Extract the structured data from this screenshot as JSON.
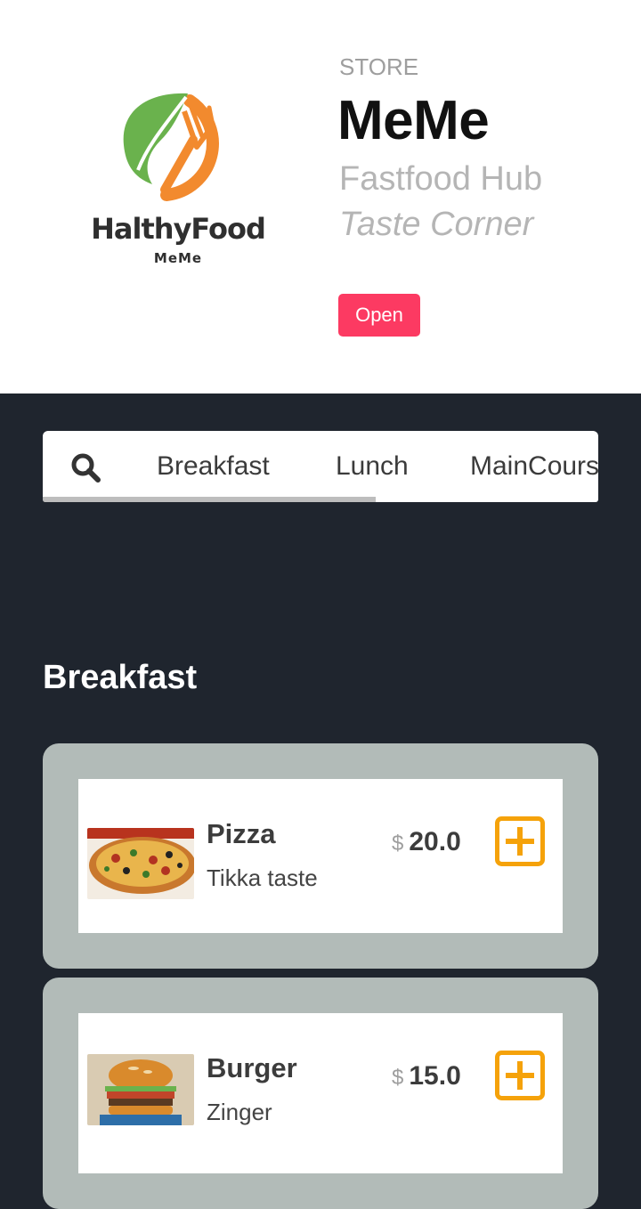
{
  "store": {
    "logo_name": "HalthyFood",
    "logo_sub": "MeMe",
    "label": "STORE",
    "name": "MeMe",
    "tagline": "Fastfood Hub",
    "tagline2": "Taste Corner",
    "status": "Open"
  },
  "tabs": [
    {
      "label": "Breakfast"
    },
    {
      "label": "Lunch"
    },
    {
      "label": "MainCourse"
    }
  ],
  "section": {
    "title": "Breakfast"
  },
  "items": [
    {
      "name": "Pizza",
      "description": "Tikka taste",
      "currency": "$",
      "price": "20.0",
      "image_icon": "pizza-photo"
    },
    {
      "name": "Burger",
      "description": "Zinger",
      "currency": "$",
      "price": "15.0",
      "image_icon": "burger-photo"
    }
  ],
  "colors": {
    "background": "#1f252e",
    "status_badge": "#fc3a62",
    "add_button": "#f5a20a",
    "card": "#b2bbb8",
    "logo_green": "#6ab24d",
    "logo_orange": "#f28a2e"
  }
}
